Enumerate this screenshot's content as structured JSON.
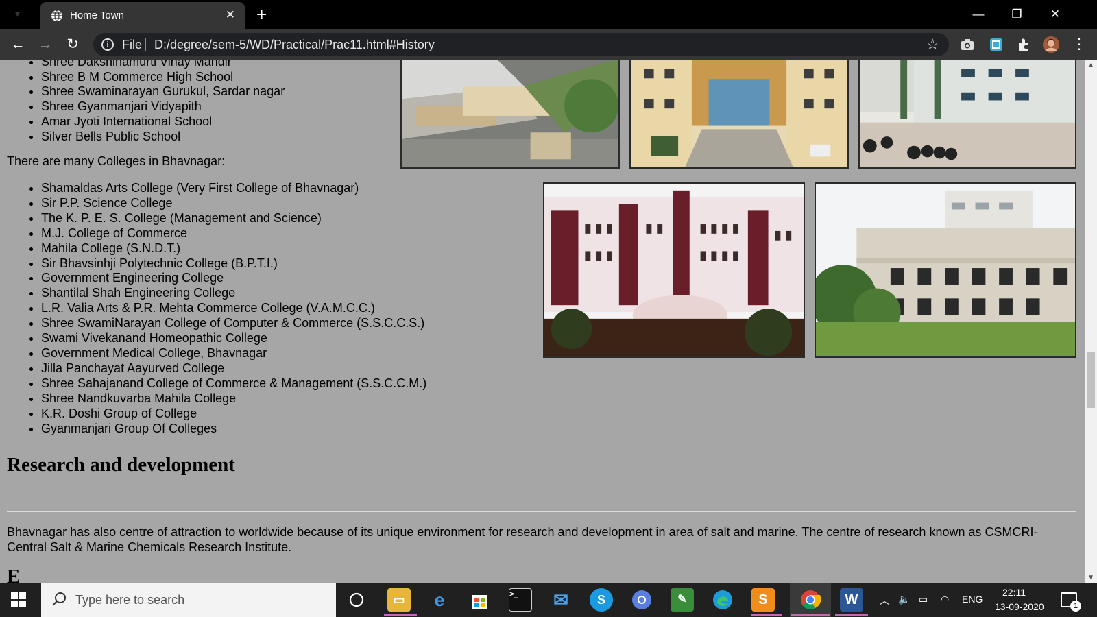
{
  "browser": {
    "tab_title": "Home Town",
    "address_scheme_label": "File",
    "url": "D:/degree/sem-5/WD/Practical/Prac11.html#History"
  },
  "page": {
    "schools_list": [
      "Shree Dakshinamurti Vinay Mandir",
      "Shree B M Commerce High School",
      "Shree Swaminarayan Gurukul, Sardar nagar",
      "Shree Gyanmanjari Vidyapith",
      "Amar Jyoti International School",
      "Silver Bells Public School"
    ],
    "colleges_intro": "There are many Colleges in Bhavnagar:",
    "colleges_list": [
      "Shamaldas Arts College (Very First College of Bhavnagar)",
      "Sir P.P. Science College",
      "The K. P. E. S. College (Management and Science)",
      "M.J. College of Commerce",
      "Mahila College (S.N.D.T.)",
      "Sir Bhavsinhji Polytechnic College (B.P.T.I.)",
      "Government Engineering College",
      "Shantilal Shah Engineering College",
      "L.R. Valia Arts & P.R. Mehta Commerce College (V.A.M.C.C.)",
      "Shree SwamiNarayan College of Computer & Commerce (S.S.C.C.S.)",
      "Swami Vivekanand Homeopathic College",
      "Government Medical College, Bhavnagar",
      "Jilla Panchayat Aayurved College",
      "Shree Sahajanand College of Commerce & Management (S.S.C.C.M.)",
      "Shree Nandkuvarba Mahila College",
      "K.R. Doshi Group of College",
      "Gyanmanjari Group Of Colleges"
    ],
    "research_heading": "Research and development",
    "research_paragraph": "Bhavnagar has also centre of attraction to worldwide because of its unique environment for research and development in area of salt and marine. The centre of research known as CSMCRI-Central Salt & Marine Chemicals Research Institute."
  },
  "taskbar": {
    "search_placeholder": "Type here to search",
    "language": "ENG",
    "time": "22:11",
    "date": "13-09-2020",
    "notification_count": "1"
  },
  "colors": {
    "page_background": "#a6a6a6",
    "tab_bar": "#000000",
    "toolbar": "#353535",
    "taskbar": "#202020"
  }
}
